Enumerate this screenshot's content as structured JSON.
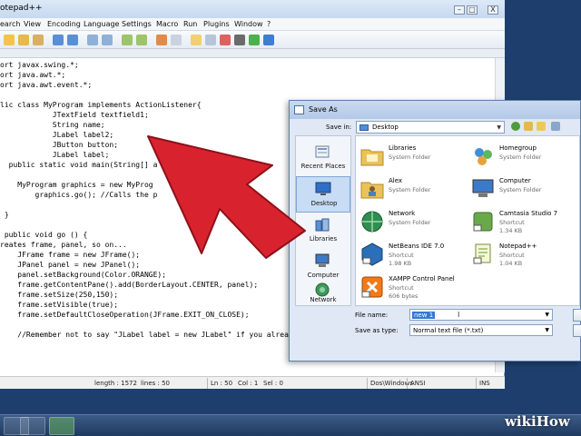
{
  "notepad": {
    "title": "otepad++",
    "menu": [
      "earch",
      "View",
      "Encoding",
      "Language",
      "Settings",
      "Macro",
      "Run",
      "Plugins",
      "Window",
      "?"
    ],
    "close_x": "X",
    "code_lines": [
      "ort javax.swing.*;",
      "ort java.awt.*;",
      "ort java.awt.event.*;",
      "",
      "lic class MyProgram implements ActionListener{",
      "            JTextField textfield1;",
      "            String name;",
      "            JLabel label2;",
      "            JButton button;",
      "            JLabel label;",
      "  public static void main(String[] a",
      "",
      "    MyProgram graphics = new MyProg",
      "        graphics.go(); //Calls the p",
      "",
      " }",
      "",
      " public void go () {",
      "reates frame, panel, so on...",
      "    JFrame frame = new JFrame();",
      "    JPanel panel = new JPanel();",
      "    panel.setBackground(Color.ORANGE);",
      "    frame.getContentPane().add(BorderLayout.CENTER, panel);",
      "    frame.setSize(250,150);",
      "    frame.setVisible(true);",
      "    frame.setDefaultCloseOperation(JFrame.EXIT_ON_CLOSE);",
      "",
      "    //Remember not to say \"JLabel label = new JLabel\" if you already made the instance variable \"JLabel l"
    ],
    "status": {
      "length": "length : 1572",
      "lines": "lines : 50",
      "ln": "Ln : 50",
      "col": "Col : 1",
      "sel": "Sel : 0",
      "eol": "Dos\\Windows",
      "encoding": "ANSI",
      "mode": "INS"
    }
  },
  "save_dialog": {
    "title": "Save As",
    "save_in_label": "Save in:",
    "save_in_value": "Desktop",
    "places": [
      "Recent Places",
      "Desktop",
      "Libraries",
      "Computer",
      "Network"
    ],
    "files": [
      {
        "name": "Libraries",
        "type": "System Folder",
        "size": ""
      },
      {
        "name": "Homegroup",
        "type": "System Folder",
        "size": ""
      },
      {
        "name": "Alex",
        "type": "System Folder",
        "size": ""
      },
      {
        "name": "Computer",
        "type": "System Folder",
        "size": ""
      },
      {
        "name": "Network",
        "type": "System Folder",
        "size": ""
      },
      {
        "name": "Camtasia Studio 7",
        "type": "Shortcut",
        "size": "1.34 KB"
      },
      {
        "name": "NetBeans IDE 7.0",
        "type": "Shortcut",
        "size": "1.98 KB"
      },
      {
        "name": "Notepad++",
        "type": "Shortcut",
        "size": "1.04 KB"
      },
      {
        "name": "XAMPP Control Panel",
        "type": "Shortcut",
        "size": "606 bytes"
      }
    ],
    "file_name_label": "File name:",
    "file_name_value": "new 1",
    "save_as_type_label": "Save as type:",
    "save_as_type_value": "Normal text file (*.txt)"
  },
  "watermark": "wikiHow",
  "colors": {
    "arrow": "#d8232f",
    "selection": "#3478d4",
    "desktop": "#1e3f6e"
  }
}
